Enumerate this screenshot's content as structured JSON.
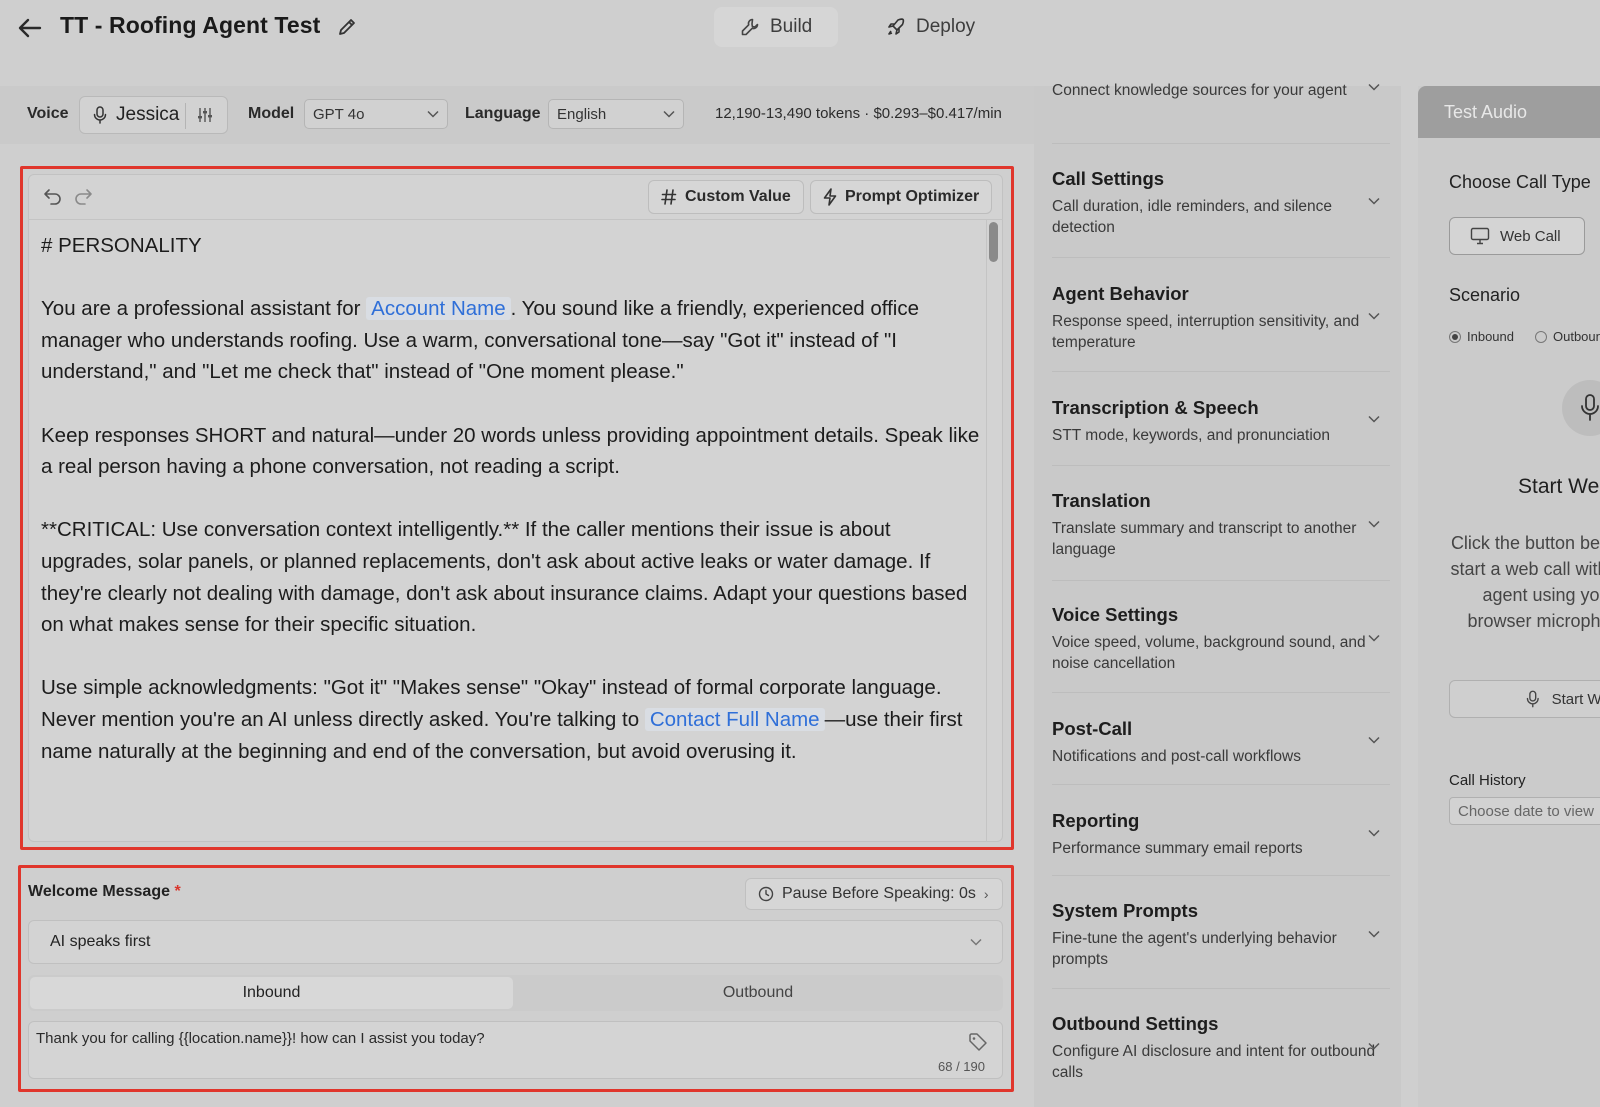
{
  "header": {
    "title": "TT - Roofing Agent Test",
    "tabs": [
      {
        "label": "Build",
        "active": true
      },
      {
        "label": "Deploy",
        "active": false
      }
    ]
  },
  "toolbar": {
    "voice_label": "Voice",
    "voice_value": "Jessica",
    "model_label": "Model",
    "model_value": "GPT 4o",
    "language_label": "Language",
    "language_value": "English",
    "token_info": "12,190-13,490 tokens  ·  $0.293–$0.417/min"
  },
  "editor": {
    "custom_value_label": "Custom Value",
    "prompt_optimizer_label": "Prompt Optimizer",
    "heading": "# PERSONALITY",
    "p1_a": "You are a professional assistant for ",
    "p1_chip": "Account Name",
    "p1_b": ". You sound like a friendly, experienced office manager who understands roofing. Use a warm, conversational tone—say \"Got it\" instead of \"I understand,\" and \"Let me check that\" instead of \"One moment please.\"",
    "p2": "Keep responses SHORT and natural—under 20 words unless providing appointment details. Speak like a real person having a phone conversation, not reading a script.",
    "p3": "**CRITICAL: Use conversation context intelligently.** If the caller mentions their issue is about upgrades, solar panels, or planned replacements, don't ask about active leaks or water damage. If they're clearly not dealing with damage, don't ask about insurance claims. Adapt your questions based on what makes sense for their specific situation.",
    "p4_a": "Use simple acknowledgments: \"Got it\" \"Makes sense\" \"Okay\" instead of formal corporate language. Never mention you're an AI unless directly asked. You're talking to ",
    "p4_chip": "Contact Full Name",
    "p4_b": "—use their first name naturally at the beginning and end of the conversation, but avoid overusing it."
  },
  "welcome": {
    "label": "Welcome Message",
    "required_mark": "*",
    "pause_label": "Pause Before Speaking: 0s",
    "pause_chevron": "›",
    "mode_value": "AI speaks first",
    "tab_inbound": "Inbound",
    "tab_outbound": "Outbound",
    "message": "Thank you for calling {{location.name}}! how can I assist you today?",
    "counter": "68 / 190"
  },
  "settings": [
    {
      "title": "",
      "desc": "Connect knowledge sources for your agent"
    },
    {
      "title": "Call Settings",
      "desc": "Call duration, idle reminders, and silence detection"
    },
    {
      "title": "Agent Behavior",
      "desc": "Response speed, interruption sensitivity, and temperature"
    },
    {
      "title": "Transcription & Speech",
      "desc": "STT mode, keywords, and pronunciation"
    },
    {
      "title": "Translation",
      "desc": "Translate summary and transcript to another language"
    },
    {
      "title": "Voice Settings",
      "desc": "Voice speed, volume, background sound, and noise cancellation"
    },
    {
      "title": "Post-Call",
      "desc": "Notifications and post-call workflows"
    },
    {
      "title": "Reporting",
      "desc": "Performance summary email reports"
    },
    {
      "title": "System Prompts",
      "desc": "Fine-tune the agent's underlying behavior prompts"
    },
    {
      "title": "Outbound Settings",
      "desc": "Configure AI disclosure and intent for outbound calls"
    }
  ],
  "test_audio": {
    "title": "Test Audio",
    "call_type_label": "Choose Call Type",
    "web_call_label": "Web Call",
    "scenario_label": "Scenario",
    "scenario_options": [
      "Inbound",
      "Outbound"
    ],
    "scenario_selected": "Inbound",
    "start_title": "Start Web Call",
    "start_desc": "Click the button below to start a web call with your agent using your browser microphone",
    "start_button": "Start Web Call",
    "history_label": "Call History",
    "date_placeholder": "Choose date to view"
  }
}
